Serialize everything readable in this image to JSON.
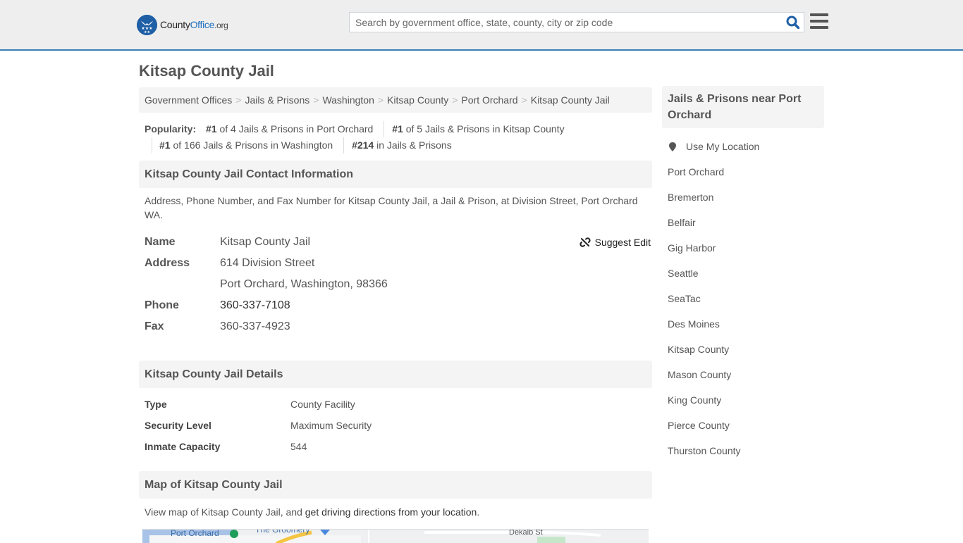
{
  "header": {
    "logo": {
      "part1": "County",
      "part2": "Office",
      "part3": ".org",
      "icon": "eagle-stars-badge-icon"
    },
    "search": {
      "placeholder": "Search by government office, state, county, city or zip code",
      "value": "",
      "icon": "search-icon"
    },
    "menu_icon": "hamburger-menu-icon",
    "accent_color": "#3a7fb5",
    "brand_color": "#1f5fa6"
  },
  "page": {
    "title": "Kitsap County Jail"
  },
  "breadcrumb": [
    "Government Offices",
    "Jails & Prisons",
    "Washington",
    "Kitsap County",
    "Port Orchard",
    "Kitsap County Jail"
  ],
  "popularity": {
    "label": "Popularity:",
    "items": [
      {
        "rank": "#1",
        "text": " of 4 Jails & Prisons in Port Orchard"
      },
      {
        "rank": "#1",
        "text": " of 5 Jails & Prisons in Kitsap County"
      },
      {
        "rank": "#1",
        "text": " of 166 Jails & Prisons in Washington"
      },
      {
        "rank": "#214",
        "text": " in Jails & Prisons"
      }
    ]
  },
  "contact": {
    "heading": "Kitsap County Jail Contact Information",
    "description": "Address, Phone Number, and Fax Number for Kitsap County Jail, a Jail & Prison, at Division Street, Port Orchard WA.",
    "suggest_edit": "Suggest Edit",
    "rows": {
      "name": {
        "label": "Name",
        "value": "Kitsap County Jail"
      },
      "address": {
        "label": "Address",
        "line1": "614 Division Street",
        "line2": "Port Orchard, Washington, 98366"
      },
      "phone": {
        "label": "Phone",
        "value": "360-337-7108"
      },
      "fax": {
        "label": "Fax",
        "value": "360-337-4923"
      }
    }
  },
  "details": {
    "heading": "Kitsap County Jail Details",
    "rows": [
      {
        "label": "Type",
        "value": "County Facility"
      },
      {
        "label": "Security Level",
        "value": "Maximum Security"
      },
      {
        "label": "Inmate Capacity",
        "value": "544"
      }
    ]
  },
  "map": {
    "heading": "Map of Kitsap County Jail",
    "text_before": "View map of Kitsap County Jail, and ",
    "link": "get driving directions from your location",
    "text_after": ".",
    "labels": [
      "Port Orchard",
      "The Groomery",
      "Dekalb St"
    ]
  },
  "sidebar": {
    "heading": "Jails & Prisons near Port Orchard",
    "use_location": "Use My Location",
    "links": [
      "Port Orchard",
      "Bremerton",
      "Belfair",
      "Gig Harbor",
      "Seattle",
      "SeaTac",
      "Des Moines",
      "Kitsap County",
      "Mason County",
      "King County",
      "Pierce County",
      "Thurston County"
    ]
  }
}
